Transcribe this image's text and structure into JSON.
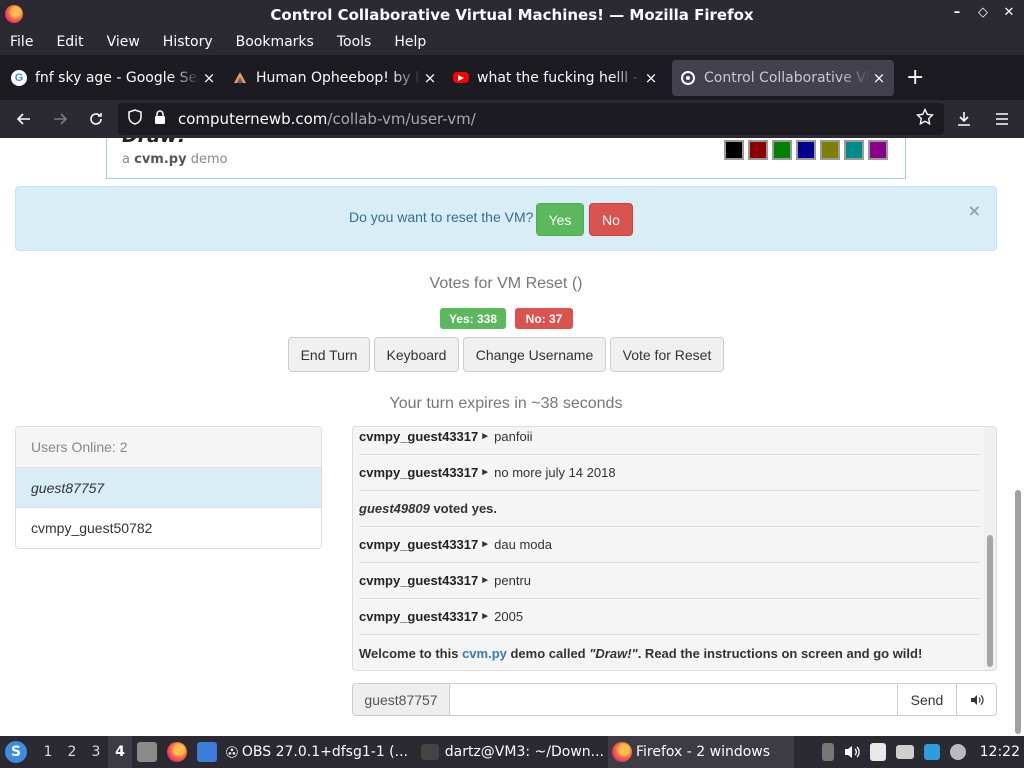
{
  "window": {
    "title": "Control Collaborative Virtual Machines! — Mozilla Firefox",
    "controls": [
      "–",
      "◇",
      "✕"
    ]
  },
  "menu": [
    "File",
    "Edit",
    "View",
    "History",
    "Bookmarks",
    "Tools",
    "Help"
  ],
  "tabs": [
    {
      "label": "fnf sky age - Google Search",
      "icon": "google-icon",
      "close": "×"
    },
    {
      "label": "Human Opheebop! by Dr",
      "icon": "rainbow-icon",
      "close": "×"
    },
    {
      "label": "what the fucking helll - YouTube",
      "icon": "youtube-icon",
      "close": "×"
    },
    {
      "label": "Control Collaborative Virtual",
      "icon": "collabvm-icon",
      "close": "×"
    }
  ],
  "new_tab": "+",
  "nav": {
    "url_host": "computernewb.com",
    "url_path": "/collab-vm/user-vm/"
  },
  "header": {
    "title": "Draw!",
    "subtitle_prefix": "a ",
    "subtitle_brand": "cvm.py",
    "subtitle_suffix": " demo",
    "palette": [
      "#000000",
      "#8b0000",
      "#008000",
      "#00008b",
      "#808000",
      "#008b8b",
      "#8b008b"
    ],
    "palette_top": [
      "#ffffff",
      "#ff0000",
      "#00cc00",
      "#0000ff",
      "#ffff00",
      "#00cccc",
      "#cc00cc"
    ]
  },
  "alert": {
    "question": "Do you want to reset the VM?",
    "yes": "Yes",
    "no": "No",
    "dismiss": "×"
  },
  "votes": {
    "title": "Votes for VM Reset ()",
    "yes_label": "Yes: 338",
    "no_label": "No: 37"
  },
  "controls": [
    "End Turn",
    "Keyboard",
    "Change Username",
    "Vote for Reset"
  ],
  "turn_text": "Your turn expires in ~38 seconds",
  "users": {
    "header": "Users Online: 2",
    "list": [
      "guest87757",
      "cvmpy_guest50782"
    ]
  },
  "chat": {
    "messages": [
      {
        "nick": "cvmpy_guest43317",
        "text": "panfoii"
      },
      {
        "nick": "cvmpy_guest43317",
        "text": "no more july 14 2018"
      },
      {
        "nick": "guest49809",
        "text": " voted yes.",
        "type": "vote"
      },
      {
        "nick": "cvmpy_guest43317",
        "text": "dau moda"
      },
      {
        "nick": "cvmpy_guest43317",
        "text": "pentru"
      },
      {
        "nick": "cvmpy_guest43317",
        "text": "2005"
      }
    ],
    "welcome": {
      "pre": "Welcome to this ",
      "link": "cvm.py",
      "mid": " demo called ",
      "name": "\"Draw!\"",
      "post": ". Read the instructions on screen and go wild!"
    },
    "username": "guest87757",
    "input_value": "",
    "send": "Send"
  },
  "taskbar": {
    "workspaces": [
      "1",
      "2",
      "3",
      "4"
    ],
    "active_workspace": "4",
    "tasks": [
      "OBS 27.0.1+dfsg1-1 (...",
      "dartz@VM3: ~/Down...",
      "Firefox - 2 windows"
    ],
    "clock": "12:22"
  }
}
